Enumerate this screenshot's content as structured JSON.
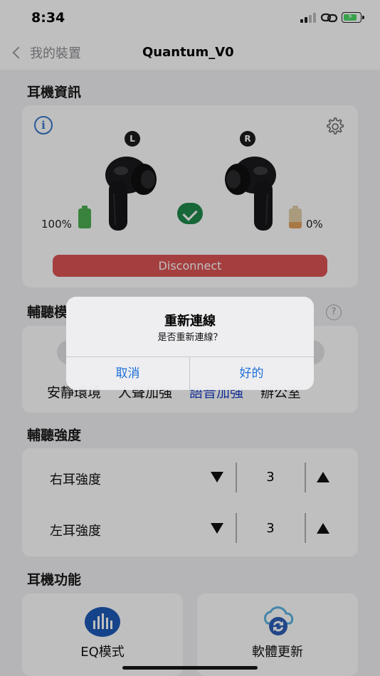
{
  "status_bar": {
    "time": "8:34",
    "battery_color": "#4cd964"
  },
  "nav": {
    "back_label": "我的裝置",
    "title": "Quantum_V0"
  },
  "earbud_section": {
    "title": "耳機資訊",
    "left_label": "L",
    "right_label": "R",
    "left_battery": "100%",
    "right_battery": "0%",
    "left_battery_level": 1.0,
    "right_battery_level": 0.0,
    "connection_status_color": "#1f8a4c",
    "disconnect_label": "Disconnect",
    "disconnect_color": "#dd5555"
  },
  "hearing_mode": {
    "title_visible": "輔聽模",
    "modes": [
      "安靜環境",
      "人聲加強",
      "語音加強",
      "辦公室"
    ],
    "active_mode_index": 2,
    "active_color": "#1a3fc7"
  },
  "intensity": {
    "title": "輔聽強度",
    "rows": [
      {
        "label": "右耳強度",
        "value": "3"
      },
      {
        "label": "左耳強度",
        "value": "3"
      }
    ]
  },
  "functions": {
    "title": "耳機功能",
    "tiles": [
      {
        "label": "EQ模式",
        "icon": "eq-bars-icon"
      },
      {
        "label": "軟體更新",
        "icon": "cloud-sync-icon"
      }
    ]
  },
  "alert": {
    "title": "重新連線",
    "message": "是否重新連線？",
    "cancel_label": "取消",
    "ok_label": "好的",
    "button_color": "#1d6fd8"
  }
}
